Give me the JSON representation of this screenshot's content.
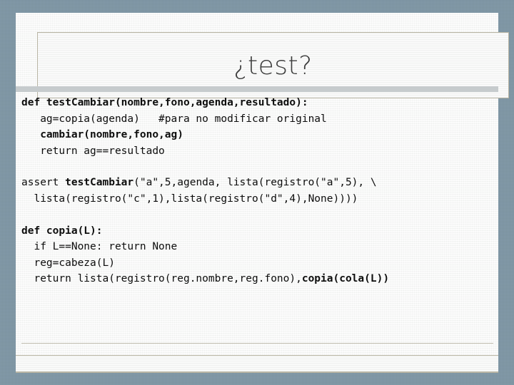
{
  "slide": {
    "title": "¿test?",
    "background_color": "#7d95a4",
    "paper_color": "#f4f5f4",
    "frame_border_color": "#b9b5a4",
    "divider_color": "#c6cbcd",
    "text_color": "#0d0d0d",
    "title_color": "#3d3d3d"
  },
  "code": {
    "blocks": [
      {
        "name": "test-function-block",
        "lines": [
          {
            "name": "code-line-def-testcambiar",
            "segments": [
              {
                "text": "def testCambiar(nombre,fono,agenda,resultado):",
                "bold": true
              }
            ]
          },
          {
            "name": "code-line-ag-copia",
            "segments": [
              {
                "text": "   ag=copia(agenda)   #para no modificar original",
                "bold": false
              }
            ]
          },
          {
            "name": "code-line-cambiar-call",
            "segments": [
              {
                "text": "   cambiar(nombre,fono,ag)",
                "bold": true
              }
            ]
          },
          {
            "name": "code-line-return-ag",
            "segments": [
              {
                "text": "   return ag==resultado",
                "bold": false
              }
            ]
          }
        ]
      },
      {
        "name": "assert-block",
        "lines": [
          {
            "name": "code-line-assert",
            "segments": [
              {
                "text": "assert ",
                "bold": false
              },
              {
                "text": "testCambiar",
                "bold": true
              },
              {
                "text": "(\"a\",5,agenda, lista(registro(\"a\",5), \\",
                "bold": false
              }
            ]
          },
          {
            "name": "code-line-assert-continuation",
            "segments": [
              {
                "text": "  lista(registro(\"c\",1),lista(registro(\"d\",4),None))))",
                "bold": false
              }
            ]
          }
        ]
      },
      {
        "name": "copia-function-block",
        "lines": [
          {
            "name": "code-line-def-copia",
            "segments": [
              {
                "text": "def copia(L):",
                "bold": true
              }
            ]
          },
          {
            "name": "code-line-if-none",
            "segments": [
              {
                "text": "  if L==None: return None",
                "bold": false
              }
            ]
          },
          {
            "name": "code-line-reg-cabeza",
            "segments": [
              {
                "text": "  reg=cabeza(L)",
                "bold": false
              }
            ]
          },
          {
            "name": "code-line-return-lista",
            "segments": [
              {
                "text": "  return lista(registro(reg.nombre,reg.fono),",
                "bold": false
              },
              {
                "text": "copia(cola(L))",
                "bold": true
              }
            ]
          }
        ]
      }
    ]
  }
}
